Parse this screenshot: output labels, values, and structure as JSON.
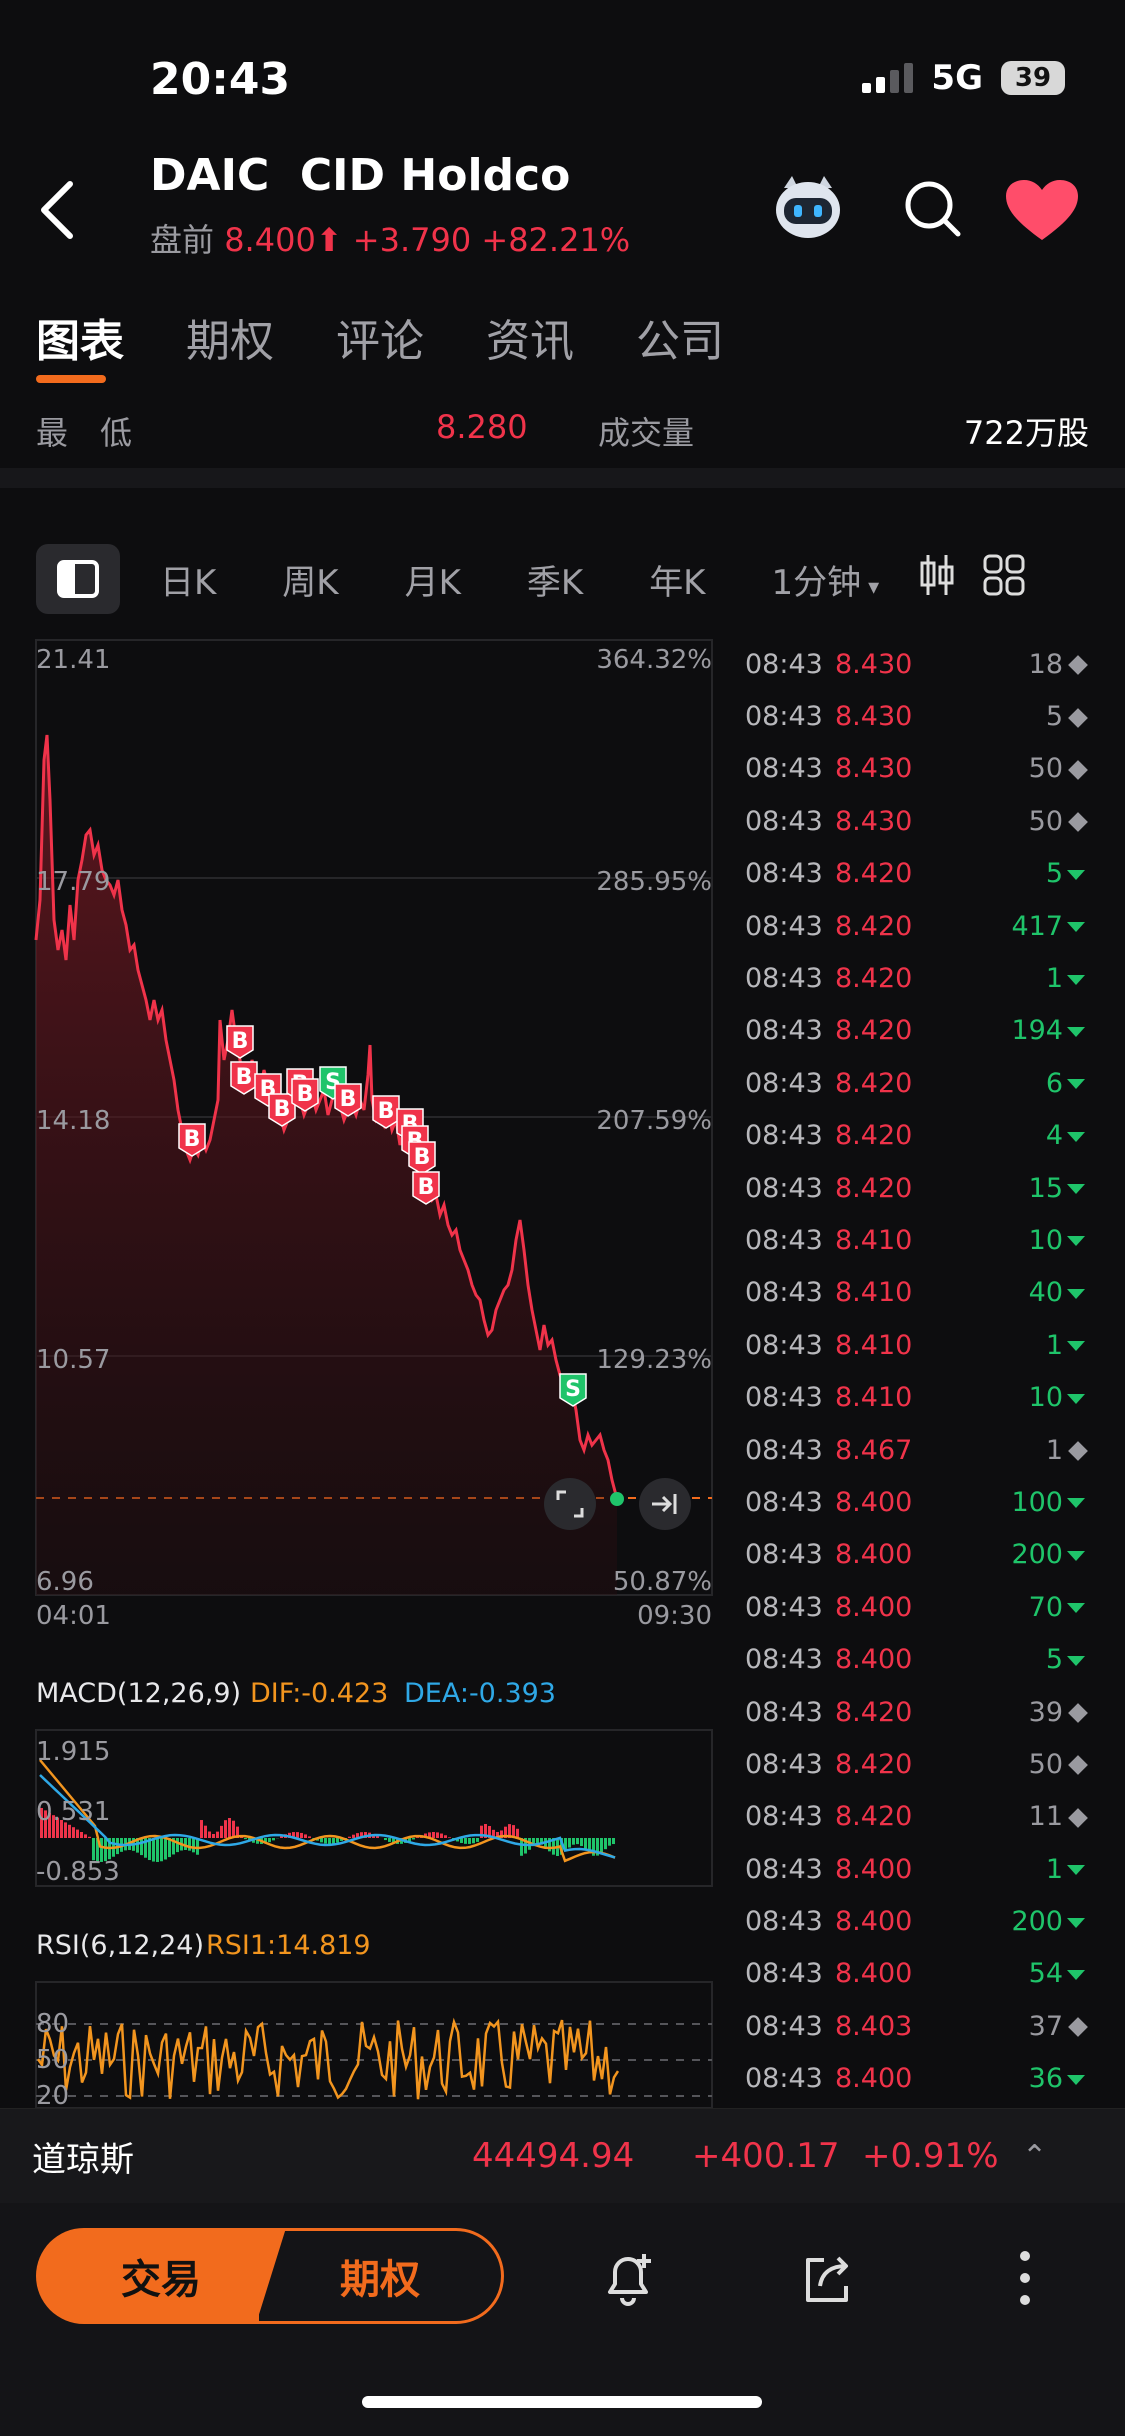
{
  "status": {
    "time": "20:43",
    "network": "5G",
    "battery": "39"
  },
  "header": {
    "ticker": "DAIC",
    "name": "CID Holdco",
    "session": "盘前",
    "price": "8.400",
    "change": "+3.790",
    "change_pct": "+82.21%"
  },
  "tabs": [
    "图表",
    "期权",
    "评论",
    "资讯",
    "公司"
  ],
  "stats": {
    "low_label": "最　低",
    "low_value": "8.280",
    "volume_label": "成交量",
    "volume_value": "722万股"
  },
  "periods": [
    "日K",
    "周K",
    "月K",
    "季K",
    "年K",
    "1分钟"
  ],
  "chart": {
    "y_labels": [
      "21.41",
      "17.79",
      "14.18",
      "10.57",
      "6.96"
    ],
    "pct_labels": [
      "364.32%",
      "285.95%",
      "207.59%",
      "129.23%",
      "50.87%"
    ],
    "time_start": "04:01",
    "time_end": "09:30",
    "buy_marker": "B",
    "sell_marker": "S"
  },
  "macd": {
    "title": "MACD(12,26,9)",
    "dif": "DIF:-0.423",
    "dea": "DEA:-0.393",
    "y_labels": [
      "1.915",
      "0.531",
      "-0.853"
    ]
  },
  "rsi": {
    "title": "RSI(6,12,24)",
    "rsi1": "RSI1:14.819",
    "y_labels": [
      "80",
      "50",
      "20"
    ]
  },
  "colors": {
    "up": "#f0334a",
    "down": "#1fc46a",
    "accent": "#f26b1d",
    "dea": "#2fa8e6"
  },
  "ticks": [
    {
      "time": "08:43",
      "price": "8.430",
      "vol": "18",
      "dir": "neutral"
    },
    {
      "time": "08:43",
      "price": "8.430",
      "vol": "5",
      "dir": "neutral"
    },
    {
      "time": "08:43",
      "price": "8.430",
      "vol": "50",
      "dir": "neutral"
    },
    {
      "time": "08:43",
      "price": "8.430",
      "vol": "50",
      "dir": "neutral"
    },
    {
      "time": "08:43",
      "price": "8.420",
      "vol": "5",
      "dir": "down"
    },
    {
      "time": "08:43",
      "price": "8.420",
      "vol": "417",
      "dir": "down"
    },
    {
      "time": "08:43",
      "price": "8.420",
      "vol": "1",
      "dir": "down"
    },
    {
      "time": "08:43",
      "price": "8.420",
      "vol": "194",
      "dir": "down"
    },
    {
      "time": "08:43",
      "price": "8.420",
      "vol": "6",
      "dir": "down"
    },
    {
      "time": "08:43",
      "price": "8.420",
      "vol": "4",
      "dir": "down"
    },
    {
      "time": "08:43",
      "price": "8.420",
      "vol": "15",
      "dir": "down"
    },
    {
      "time": "08:43",
      "price": "8.410",
      "vol": "10",
      "dir": "down"
    },
    {
      "time": "08:43",
      "price": "8.410",
      "vol": "40",
      "dir": "down"
    },
    {
      "time": "08:43",
      "price": "8.410",
      "vol": "1",
      "dir": "down"
    },
    {
      "time": "08:43",
      "price": "8.410",
      "vol": "10",
      "dir": "down"
    },
    {
      "time": "08:43",
      "price": "8.467",
      "vol": "1",
      "dir": "neutral"
    },
    {
      "time": "08:43",
      "price": "8.400",
      "vol": "100",
      "dir": "down"
    },
    {
      "time": "08:43",
      "price": "8.400",
      "vol": "200",
      "dir": "down"
    },
    {
      "time": "08:43",
      "price": "8.400",
      "vol": "70",
      "dir": "down"
    },
    {
      "time": "08:43",
      "price": "8.400",
      "vol": "5",
      "dir": "down"
    },
    {
      "time": "08:43",
      "price": "8.420",
      "vol": "39",
      "dir": "neutral"
    },
    {
      "time": "08:43",
      "price": "8.420",
      "vol": "50",
      "dir": "neutral"
    },
    {
      "time": "08:43",
      "price": "8.420",
      "vol": "11",
      "dir": "neutral"
    },
    {
      "time": "08:43",
      "price": "8.400",
      "vol": "1",
      "dir": "down"
    },
    {
      "time": "08:43",
      "price": "8.400",
      "vol": "200",
      "dir": "down"
    },
    {
      "time": "08:43",
      "price": "8.400",
      "vol": "54",
      "dir": "down"
    },
    {
      "time": "08:43",
      "price": "8.403",
      "vol": "37",
      "dir": "neutral"
    },
    {
      "time": "08:43",
      "price": "8.400",
      "vol": "36",
      "dir": "down"
    }
  ],
  "index_bar": {
    "name": "道琼斯",
    "value": "44494.94",
    "change": "+400.17",
    "change_pct": "+0.91%"
  },
  "bottom": {
    "trade_label": "交易",
    "options_label": "期权"
  }
}
